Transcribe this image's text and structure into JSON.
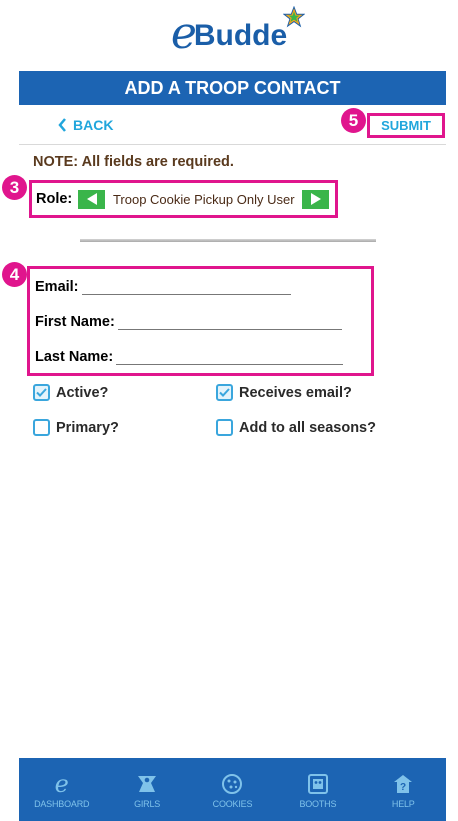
{
  "logo": {
    "e": "e",
    "text": "Budde"
  },
  "header": {
    "title": "ADD A TROOP CONTACT"
  },
  "nav": {
    "back_label": "BACK",
    "submit_label": "SUBMIT"
  },
  "badges": {
    "role": "3",
    "fields": "4",
    "submit": "5"
  },
  "form": {
    "note": "NOTE: All fields are required.",
    "role_label": "Role:",
    "role_value": "Troop Cookie Pickup Only User",
    "email_label": "Email:",
    "email_value": "",
    "first_name_label": "First Name:",
    "first_name_value": "",
    "last_name_label": "Last Name:",
    "last_name_value": ""
  },
  "checkboxes": [
    {
      "label": "Active?",
      "checked": true
    },
    {
      "label": "Receives email?",
      "checked": true
    },
    {
      "label": "Primary?",
      "checked": false
    },
    {
      "label": "Add to all seasons?",
      "checked": false
    }
  ],
  "tabbar": [
    {
      "label": "DASHBOARD",
      "icon": "ebudde-e-icon"
    },
    {
      "label": "GIRLS",
      "icon": "girl-icon"
    },
    {
      "label": "COOKIES",
      "icon": "cookie-icon"
    },
    {
      "label": "BOOTHS",
      "icon": "booth-icon"
    },
    {
      "label": "HELP",
      "icon": "help-icon"
    }
  ],
  "colors": {
    "primary": "#1c64b3",
    "accent": "#21a6dc",
    "highlight": "#e0158d",
    "arrow": "#3ab54a"
  }
}
